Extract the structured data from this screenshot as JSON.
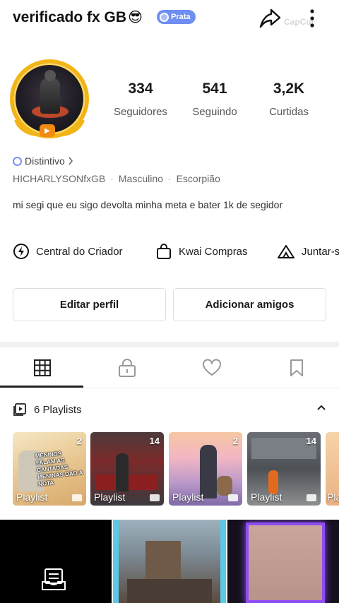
{
  "header": {
    "title": "verificado fx GB",
    "title_emoji": "😎",
    "badge_label": "Prata",
    "icons": [
      "share-icon",
      "more-vertical-icon"
    ],
    "watermark": "CapCut"
  },
  "profile": {
    "stats": [
      {
        "value": "334",
        "label": "Seguidores"
      },
      {
        "value": "541",
        "label": "Seguindo"
      },
      {
        "value": "3,2K",
        "label": "Curtidas"
      }
    ],
    "distintivo_label": "Distintivo",
    "username": "HICHARLYSONfxGB",
    "gender": "Masculino",
    "sign": "Escorpião",
    "bio": "mi segi que eu sigo devolta minha meta e  bater 1k de segidor"
  },
  "shortcuts": [
    {
      "label": "Central do Criador",
      "icon": "bolt-circle-icon"
    },
    {
      "label": "Kwai Compras",
      "icon": "shopping-bag-icon"
    },
    {
      "label": "Juntar-s",
      "icon": "tent-icon"
    }
  ],
  "buttons": {
    "edit_profile": "Editar perfil",
    "add_friends": "Adicionar amigos"
  },
  "tabs": [
    "grid-icon",
    "lock-icon",
    "heart-icon",
    "bookmark-icon"
  ],
  "playlists": {
    "label": "6 Playlists",
    "items": [
      {
        "label": "Playlist",
        "count": "2",
        "caption": "MENINOS FALAM AS CANTADAS MENINAS DÃO A NOTA"
      },
      {
        "label": "Playlist",
        "count": "14"
      },
      {
        "label": "Playlist",
        "count": "2"
      },
      {
        "label": "Playlist",
        "count": "14"
      },
      {
        "label": "Pla"
      }
    ]
  },
  "colors": {
    "accent_badge": "#6f8ef2",
    "avatar_ring": "#f2b417"
  }
}
